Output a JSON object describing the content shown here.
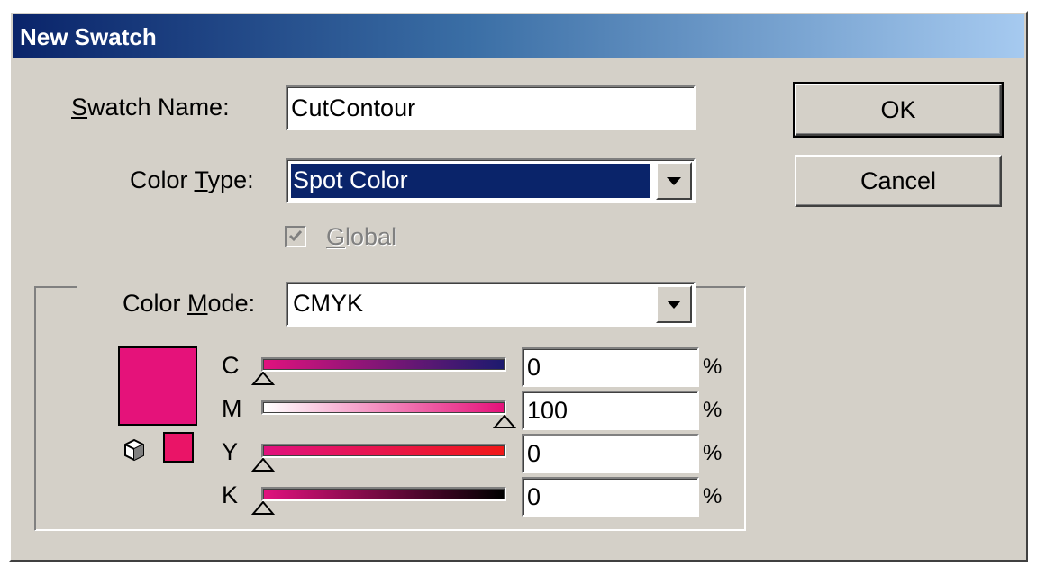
{
  "window": {
    "title": "New Swatch"
  },
  "swatch_name": {
    "label_prefix": "S",
    "label_rest": "watch Name:",
    "value": "CutContour"
  },
  "color_type": {
    "label_pre": "Color ",
    "label_key": "T",
    "label_post": "ype:",
    "value": "Spot Color"
  },
  "global": {
    "label_key": "G",
    "label_rest": "lobal",
    "checked": true,
    "enabled": false
  },
  "color_mode": {
    "label_pre": "Color ",
    "label_key": "M",
    "label_post": "ode:",
    "value": "CMYK"
  },
  "buttons": {
    "ok": "OK",
    "cancel": "Cancel"
  },
  "swatch_color": "#e5127a",
  "swatch_small_color": "#ea1467",
  "channels": [
    {
      "name": "C",
      "value": "0",
      "fraction": 0.0,
      "unit": "%",
      "gradient": [
        "#e0127e",
        "#1c1a6e"
      ]
    },
    {
      "name": "M",
      "value": "100",
      "fraction": 1.0,
      "unit": "%",
      "gradient": [
        "#ffffff",
        "#e5127a"
      ]
    },
    {
      "name": "Y",
      "value": "0",
      "fraction": 0.0,
      "unit": "%",
      "gradient": [
        "#e0127e",
        "#f01818"
      ]
    },
    {
      "name": "K",
      "value": "0",
      "fraction": 0.0,
      "unit": "%",
      "gradient": [
        "#e0127e",
        "#000000"
      ]
    }
  ]
}
